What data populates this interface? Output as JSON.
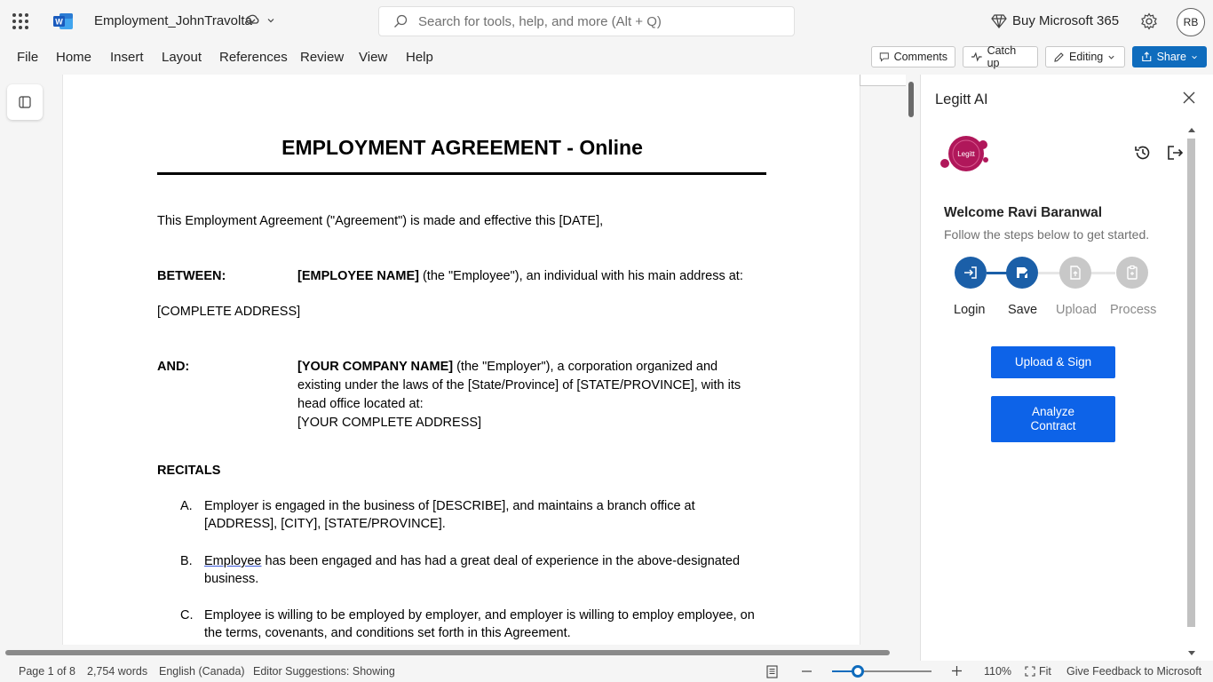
{
  "titlebar": {
    "doc_title": "Employment_JohnTravolta",
    "search_placeholder": "Search for tools, help, and more (Alt + Q)",
    "buy_label": "Buy Microsoft 365",
    "avatar_initials": "RB"
  },
  "menu": {
    "items": [
      "File",
      "Home",
      "Insert",
      "Layout",
      "References",
      "Review",
      "View",
      "Help"
    ],
    "comments_label": "Comments",
    "catchup_label": "Catch up",
    "editing_label": "Editing",
    "share_label": "Share"
  },
  "document": {
    "title": "EMPLOYMENT AGREEMENT - Online",
    "intro": "This Employment Agreement (\"Agreement\") is made and effective this [DATE],",
    "between_label": "BETWEEN:",
    "employee_name": "[EMPLOYEE NAME]",
    "employee_desc": " (the \"Employee\"), an individual with his main address at:",
    "complete_address": "[COMPLETE ADDRESS]",
    "and_label": "AND:",
    "company_name": "[YOUR COMPANY NAME]",
    "company_desc_1": " (the \"Employer\"), a corporation organized and",
    "company_desc_2": "existing under the laws of the [State/Province] of [STATE/PROVINCE], with its",
    "company_desc_3": "head office located at:",
    "company_address": "[YOUR COMPLETE ADDRESS]",
    "recitals_label": "RECITALS",
    "recitals": [
      {
        "letter": "A.",
        "line1": "Employer is engaged in the business of [DESCRIBE], and maintains a branch office at",
        "line2": "[ADDRESS], [CITY], [STATE/PROVINCE]."
      },
      {
        "letter": "B.",
        "first_word": "Employee",
        "line1_rest": " has been engaged and has had a great deal of experience in the above-designated",
        "line2": "business."
      },
      {
        "letter": "C.",
        "line1": "Employee is willing to be employed by employer, and employer is willing to employ employee, on",
        "line2": "the terms, covenants, and conditions set forth in this Agreement."
      }
    ]
  },
  "panel": {
    "title": "Legitt AI",
    "logo_text": "Legitt",
    "welcome": "Welcome Ravi Baranwal",
    "follow": "Follow the steps below to get started.",
    "steps": [
      {
        "label": "Login",
        "state": "done"
      },
      {
        "label": "Save",
        "state": "done"
      },
      {
        "label": "Upload",
        "state": "pending"
      },
      {
        "label": "Process",
        "state": "pending"
      }
    ],
    "upload_sign_label": "Upload & Sign",
    "analyze_line1": "Analyze",
    "analyze_line2": "Contract"
  },
  "statusbar": {
    "page_info": "Page 1 of 8",
    "word_count": "2,754 words",
    "language": "English (Canada)",
    "editor": "Editor Suggestions: Showing",
    "zoom": "110%",
    "fit": "Fit",
    "feedback": "Give Feedback to Microsoft"
  },
  "colors": {
    "accent": "#0f6cbd",
    "panel_button": "#0d63e8",
    "step_done": "#1b5fa8",
    "step_pending": "#c8c8c8",
    "logo": "#b0175a"
  }
}
